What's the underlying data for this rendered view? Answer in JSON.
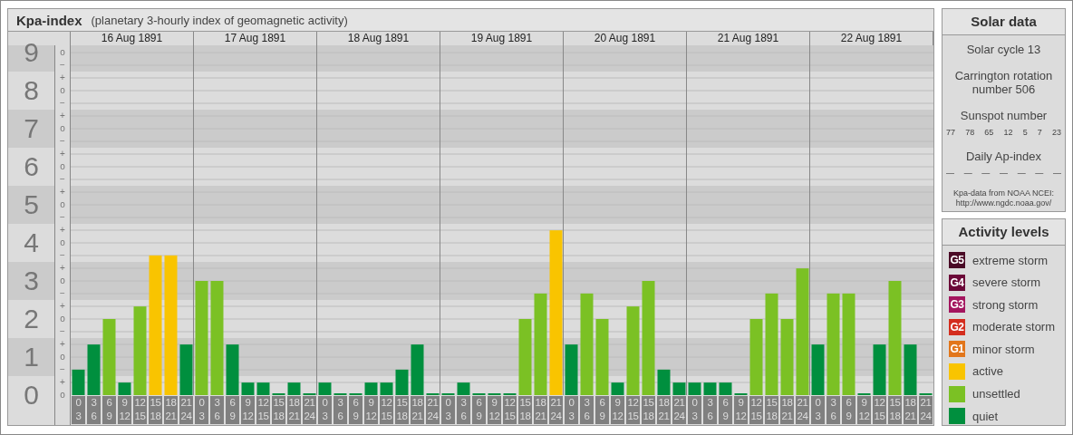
{
  "kp_panel": {
    "title": "Kpa-index",
    "subtitle": "(planetary 3-hourly index of geomagnetic activity)",
    "days": [
      "16 Aug 1891",
      "17 Aug 1891",
      "18 Aug 1891",
      "19 Aug 1891",
      "20 Aug 1891",
      "21 Aug 1891",
      "22 Aug 1891"
    ],
    "sub_marks": [
      "o",
      "−",
      "+",
      "o",
      "−",
      "+",
      "o",
      "−",
      "+",
      "o",
      "−",
      "+",
      "o",
      "−",
      "+",
      "o",
      "−",
      "+",
      "o",
      "−",
      "+",
      "o",
      "−",
      "+",
      "o",
      "−",
      "+",
      "o"
    ],
    "chart_data": {
      "type": "bar",
      "stacked": true,
      "grid": true,
      "ylim": [
        0,
        9
      ],
      "yticks": [
        0,
        1,
        2,
        3,
        4,
        5,
        6,
        7,
        8,
        9
      ],
      "categories": [
        "0\n3",
        "3\n6",
        "6\n9",
        "9\n12",
        "12\n15",
        "15\n18",
        "18\n21",
        "21\n24",
        "0\n3",
        "3\n6",
        "6\n9",
        "9\n12",
        "12\n15",
        "15\n18",
        "18\n21",
        "21\n24",
        "0\n3",
        "3\n6",
        "6\n9",
        "9\n12",
        "12\n15",
        "15\n18",
        "18\n21",
        "21\n24",
        "0\n3",
        "3\n6",
        "6\n9",
        "9\n12",
        "12\n15",
        "15\n18",
        "18\n21",
        "21\n24",
        "0\n3",
        "3\n6",
        "6\n9",
        "9\n12",
        "12\n15",
        "15\n18",
        "18\n21",
        "21\n24",
        "0\n3",
        "3\n6",
        "6\n9",
        "9\n12",
        "12\n15",
        "15\n18",
        "18\n21",
        "21\n24",
        "0\n3",
        "3\n6",
        "6\n9",
        "9\n12",
        "12\n15",
        "15\n18",
        "18\n21",
        "21\n24"
      ],
      "series": [
        {
          "name": "quiet",
          "color": "#008f3e",
          "values": [
            0.67,
            1.33,
            null,
            0.33,
            null,
            null,
            null,
            1.33,
            null,
            null,
            1.33,
            0.33,
            0.33,
            0,
            0.33,
            0,
            0.33,
            0,
            0,
            0.33,
            0.33,
            0.67,
            1.33,
            0,
            0,
            0.33,
            0,
            0,
            0,
            null,
            null,
            null,
            1.33,
            null,
            null,
            0.33,
            null,
            null,
            0.67,
            0.33,
            0.33,
            0.33,
            0.33,
            0,
            null,
            null,
            null,
            null,
            1.33,
            null,
            null,
            0,
            1.33,
            null,
            1.33,
            0
          ]
        },
        {
          "name": "unsettled",
          "color": "#7bc124",
          "values": [
            null,
            null,
            2,
            null,
            2.33,
            null,
            null,
            null,
            3,
            3,
            null,
            null,
            null,
            null,
            null,
            null,
            null,
            null,
            null,
            null,
            null,
            null,
            null,
            null,
            null,
            null,
            null,
            null,
            null,
            2,
            2.67,
            null,
            null,
            2.67,
            2,
            null,
            2.33,
            3,
            null,
            null,
            null,
            null,
            null,
            null,
            2,
            2.67,
            2,
            3.33,
            null,
            2.67,
            2.67,
            null,
            null,
            3,
            null,
            null
          ]
        },
        {
          "name": "active",
          "color": "#f9c400",
          "values": [
            null,
            null,
            null,
            null,
            null,
            3.67,
            3.67,
            null,
            null,
            null,
            null,
            null,
            null,
            null,
            null,
            null,
            null,
            null,
            null,
            null,
            null,
            null,
            null,
            null,
            null,
            null,
            null,
            null,
            null,
            null,
            null,
            4.33,
            null,
            null,
            null,
            null,
            null,
            null,
            null,
            null,
            null,
            null,
            null,
            null,
            null,
            null,
            null,
            null,
            null,
            null,
            null,
            null,
            null,
            null,
            null,
            null
          ]
        }
      ]
    }
  },
  "solar_data": {
    "title": "Solar data",
    "cycle": "Solar cycle 13",
    "rotation": "Carrington rotation number 506",
    "sunspot_label": "Sunspot number",
    "sunspots": [
      "77",
      "78",
      "65",
      "12",
      "5",
      "7",
      "23"
    ],
    "ap_label": "Daily Ap-index",
    "ap_values": [
      "—",
      "—",
      "—",
      "—",
      "—",
      "—",
      "—"
    ],
    "source": "Kpa-data from NOAA NCEI:",
    "source_url": "http://www.ngdc.noaa.gov/"
  },
  "legend": {
    "title": "Activity levels",
    "items": [
      {
        "code": "G5",
        "label": "extreme storm",
        "color": "#4a0a26"
      },
      {
        "code": "G4",
        "label": "severe storm",
        "color": "#6b0838"
      },
      {
        "code": "G3",
        "label": "strong storm",
        "color": "#a3155e"
      },
      {
        "code": "G2",
        "label": "moderate storm",
        "color": "#d42d1e"
      },
      {
        "code": "G1",
        "label": "minor storm",
        "color": "#e2761b"
      }
    ]
  }
}
